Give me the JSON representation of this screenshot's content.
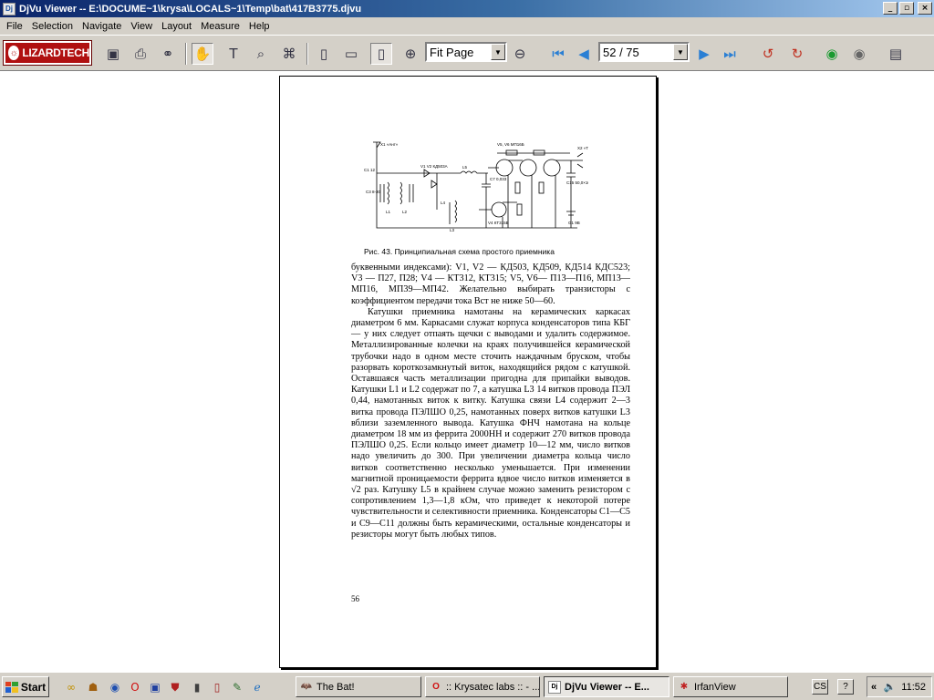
{
  "window": {
    "title": "DjVu Viewer -- E:\\DOCUME~1\\krysa\\LOCALS~1\\Temp\\bat\\417B3775.djvu",
    "controls": [
      "_",
      "▫",
      "×"
    ]
  },
  "menu": [
    "File",
    "Selection",
    "Navigate",
    "View",
    "Layout",
    "Measure",
    "Help"
  ],
  "toolbar": {
    "logo": "LIZARDTECH",
    "zoom_value": "Fit Page",
    "page_value": "52 / 75"
  },
  "document": {
    "caption": "Рис. 43. Принципиальная схема простого приемника",
    "paragraphs": [
      "буквенными индексами): V1, V2 — КД503, КД509, КД514 КДС523; V3 — П27, П28; V4 — КТ312, КТ315; V5, V6— П13—П16, МП13—МП16, МП39—МП42. Желательно выбирать транзисторы с коэффициентом передачи тока Bст не ниже 50—60.",
      "Катушки приемника намотаны на керамических каркасах диаметром 6 мм. Каркасами служат корпуса конденсаторов типа КБГ — у них следует отпаять щечки с выводами и удалить содержимое. Металлизированные колечки на краях получившейся керамической трубочки надо в одном месте сточить наждачным бруском, чтобы разорвать короткозамкнутый виток, находящийся рядом с катушкой. Оставшаяся часть металлизации пригодна для припайки выводов. Катушки L1 и L2 содержат по 7, а катушка L3 14 витков провода ПЭЛ 0,44, намотанных виток к витку. Катушка связи L4 содержит 2—3 витка провода ПЭЛШО 0,25, намотанных поверх витков катушки L3 вблизи заземленного вывода. Катушка ФНЧ намотана на кольце диаметром 18 мм из феррита 2000НН и содержит 270 витков провода ПЭЛШО 0,25. Если кольцо имеет диаметр 10—12 мм, число витков надо увеличить до 300. При увеличении диаметра кольца число витков соответственно несколько уменьшается. При изменении магнитной проницаемости феррита вдвое число витков изменяется в √2 раз. Катушку L5 в крайнем случае можно заменить резистором с сопротивлением 1,3—1,8 кОм, что приведет к некоторой потере чувствительности и селективности приемника. Конденсаторы C1—C5 и C9—C11 должны быть керамическими, остальные конденсаторы и резисторы могут быть любых типов."
    ],
    "page_number": "56"
  },
  "taskbar": {
    "start_label": "Start",
    "tasks": [
      {
        "label": "The Bat!",
        "icon": "bat-icon",
        "active": false
      },
      {
        "label": ":: Krysatec labs :: - ...",
        "icon": "opera-icon",
        "active": false
      },
      {
        "label": "DjVu Viewer -- E...",
        "icon": "djvu-icon",
        "active": true
      },
      {
        "label": "IrfanView",
        "icon": "irfanview-icon",
        "active": false
      }
    ],
    "lang": "CS",
    "help": "?",
    "clock": "11:52"
  }
}
